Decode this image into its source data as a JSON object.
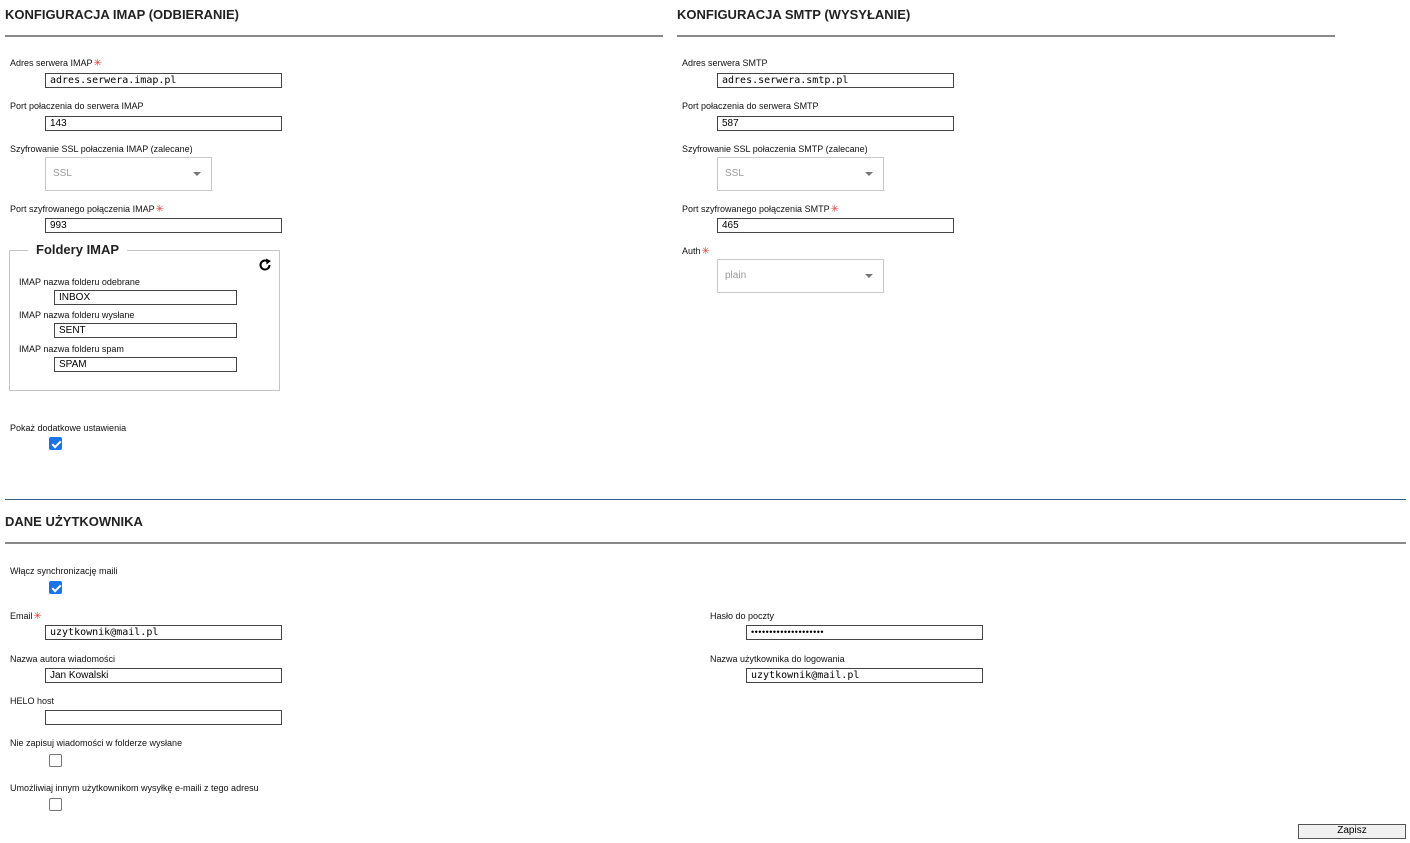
{
  "imap": {
    "title": "KONFIGURACJA IMAP (ODBIERANIE)",
    "server_label": "Adres serwera IMAP",
    "server_value": "adres.serwera.imap.pl",
    "port_label": "Port połaczenia do serwera IMAP",
    "port_value": "143",
    "ssl_label": "Szyfrowanie SSL połaczenia IMAP (zalecane)",
    "ssl_value": "SSL",
    "ssl_port_label": "Port szyfrowanego połączenia IMAP",
    "ssl_port_value": "993",
    "folders": {
      "legend": "Foldery IMAP",
      "refresh_icon": "refresh-icon",
      "inbox_label": "IMAP nazwa folderu odebrane",
      "inbox_value": "INBOX",
      "sent_label": "IMAP nazwa folderu wysłane",
      "sent_value": "SENT",
      "spam_label": "IMAP nazwa folderu spam",
      "spam_value": "SPAM"
    },
    "show_more_label": "Pokaż dodatkowe ustawienia",
    "show_more_checked": true
  },
  "smtp": {
    "title": "KONFIGURACJA SMTP (WYSYŁANIE)",
    "server_label": "Adres serwera SMTP",
    "server_value": "adres.serwera.smtp.pl",
    "port_label": "Port połaczenia do serwera SMTP",
    "port_value": "587",
    "ssl_label": "Szyfrowanie SSL połaczenia SMTP (zalecane)",
    "ssl_value": "SSL",
    "ssl_port_label": "Port szyfrowanego połączenia SMTP",
    "ssl_port_value": "465",
    "auth_label": "Auth",
    "auth_value": "plain"
  },
  "user": {
    "title": "DANE UŻYTKOWNIKA",
    "sync_label": "Włącz synchronizację maili",
    "sync_checked": true,
    "email_label": "Email",
    "email_value": "uzytkownik@mail.pl",
    "author_label": "Nazwa autora wiadomości",
    "author_value": "Jan Kowalski",
    "helo_label": "HELO host",
    "helo_value": "",
    "nosave_label": "Nie zapisuj wiadomości w folderze wysłane",
    "nosave_checked": false,
    "allow_label": "Umożliwiaj innym użytkownikom wysyłkę e-maili z tego adresu",
    "allow_checked": false,
    "password_label": "Hasło do poczty",
    "password_value": "••••••••••••••••••••",
    "login_label": "Nazwa użytkownika do logowania",
    "login_value": "uzytkownik@mail.pl"
  },
  "save_label": "Zapisz",
  "colors": {
    "required": "#e04040",
    "checkbox": "#1a73e8",
    "rule": "#8a8a8a",
    "rule_blue": "#2b5f8a"
  }
}
